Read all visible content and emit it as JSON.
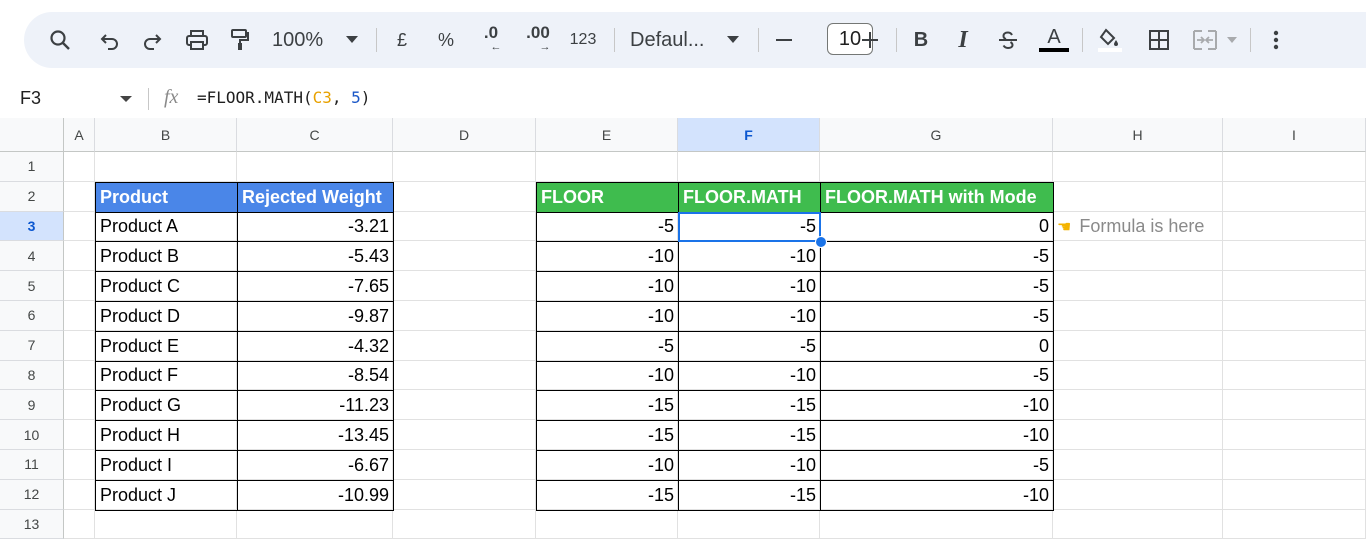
{
  "toolbar": {
    "zoom": "100%",
    "currency": "£",
    "percent": "%",
    "decrease_decimal": ".0",
    "increase_decimal": ".00",
    "format_number": "123",
    "font": "Defaul...",
    "font_size": "10",
    "bold": "B",
    "italic": "I",
    "text_color_letter": "A"
  },
  "formula_bar": {
    "cell_ref": "F3",
    "fx": "fx",
    "formula_prefix": "=FLOOR.MATH(",
    "formula_ref": "C3",
    "formula_sep": ", ",
    "formula_num": "5",
    "formula_suffix": ")"
  },
  "columns": [
    "A",
    "B",
    "C",
    "D",
    "E",
    "F",
    "G",
    "H",
    "I"
  ],
  "rows": [
    "1",
    "2",
    "3",
    "4",
    "5",
    "6",
    "7",
    "8",
    "9",
    "10",
    "11",
    "12",
    "13"
  ],
  "selected_cell": {
    "col": "F",
    "row": "3"
  },
  "products_table": {
    "headers": [
      "Product",
      "Rejected Weight"
    ],
    "rows": [
      [
        "Product A",
        "-3.21"
      ],
      [
        "Product B",
        "-5.43"
      ],
      [
        "Product C",
        "-7.65"
      ],
      [
        "Product D",
        "-9.87"
      ],
      [
        "Product E",
        "-4.32"
      ],
      [
        "Product F",
        "-8.54"
      ],
      [
        "Product G",
        "-11.23"
      ],
      [
        "Product H",
        "-13.45"
      ],
      [
        "Product I",
        "-6.67"
      ],
      [
        "Product J",
        "-10.99"
      ]
    ]
  },
  "results_table": {
    "headers": [
      "FLOOR",
      "FLOOR.MATH",
      "FLOOR.MATH with Mode"
    ],
    "rows": [
      [
        "-5",
        "-5",
        "0"
      ],
      [
        "-10",
        "-10",
        "-5"
      ],
      [
        "-10",
        "-10",
        "-5"
      ],
      [
        "-10",
        "-10",
        "-5"
      ],
      [
        "-5",
        "-5",
        "0"
      ],
      [
        "-10",
        "-10",
        "-5"
      ],
      [
        "-15",
        "-15",
        "-10"
      ],
      [
        "-15",
        "-15",
        "-10"
      ],
      [
        "-10",
        "-10",
        "-5"
      ],
      [
        "-15",
        "-15",
        "-10"
      ]
    ]
  },
  "note": {
    "icon": "pointing-hand-icon",
    "text": "Formula is here"
  },
  "colors": {
    "blue_header": "#4a86e8",
    "green_header": "#3fbc4e",
    "selection": "#1a73e8"
  }
}
